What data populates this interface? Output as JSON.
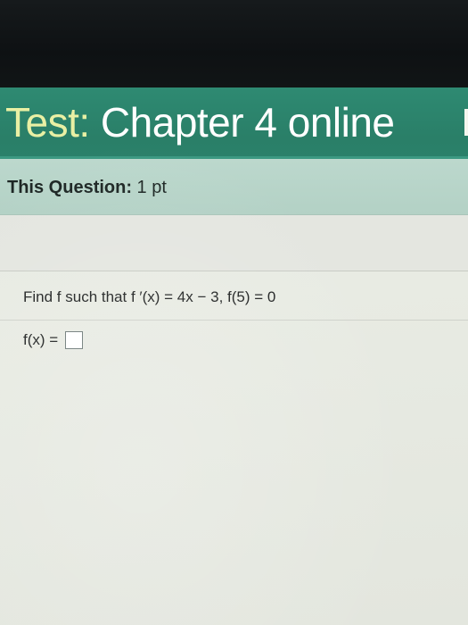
{
  "page": {
    "title_prefix": "Test:",
    "title_rest": " Chapter 4 online"
  },
  "question_header": {
    "label": "This Question:",
    "value": " 1 pt"
  },
  "question": {
    "prompt": "Find f such that f ′(x) = 4x − 3, f(5) = 0",
    "answer_label": "f(x) =",
    "answer_value": ""
  },
  "colors": {
    "title_bar": "#2b806a",
    "subheader": "#b3d1c5",
    "content_bg": "#e6e9e2"
  }
}
